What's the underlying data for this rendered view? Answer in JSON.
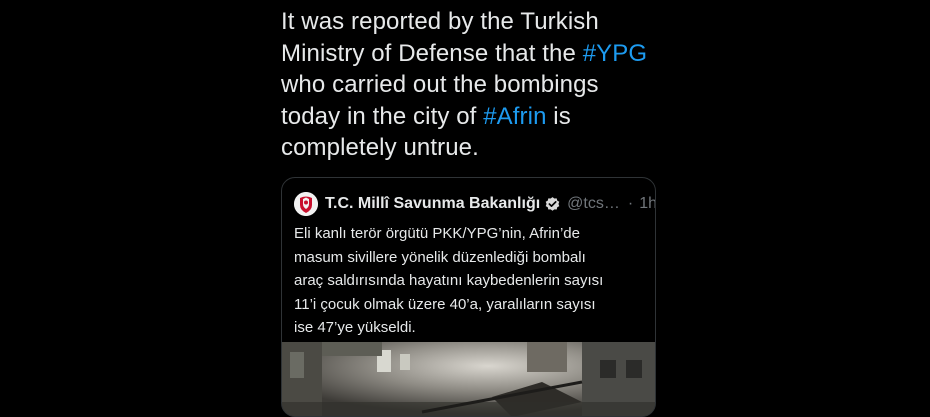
{
  "tweet": {
    "lines": [
      {
        "parts": [
          {
            "text": "It was reported by the Turkish"
          }
        ]
      },
      {
        "parts": [
          {
            "text": "Ministry of Defense that the "
          },
          {
            "text": "#YPG",
            "hashtag": true
          }
        ]
      },
      {
        "parts": [
          {
            "text": "who carried out the bombings"
          }
        ]
      },
      {
        "parts": [
          {
            "text": "today in the city of "
          },
          {
            "text": "#Afrin",
            "hashtag": true
          },
          {
            "text": " is"
          }
        ]
      },
      {
        "parts": [
          {
            "text": "completely untrue."
          }
        ]
      }
    ]
  },
  "quote": {
    "name": "T.C. Millî Savunma Bakanlığı",
    "handle": "@tcs…",
    "separator": "·",
    "time": "1h",
    "body_lines": [
      "Eli kanlı terör örgütü PKK/YPG’nin, Afrin’de",
      "masum sivillere yönelik düzenlediği bombalı",
      "araç saldırısında hayatını kaybedenlerin sayısı",
      "11’i çocuk olmak üzere 40’a, yaralıların sayısı",
      "ise 47’ye yükseldi."
    ]
  },
  "colors": {
    "background": "#000000",
    "text": "#e7e9ea",
    "hashtag": "#1d9bf0",
    "muted": "#71767b",
    "verified": "#d9d9d9"
  }
}
